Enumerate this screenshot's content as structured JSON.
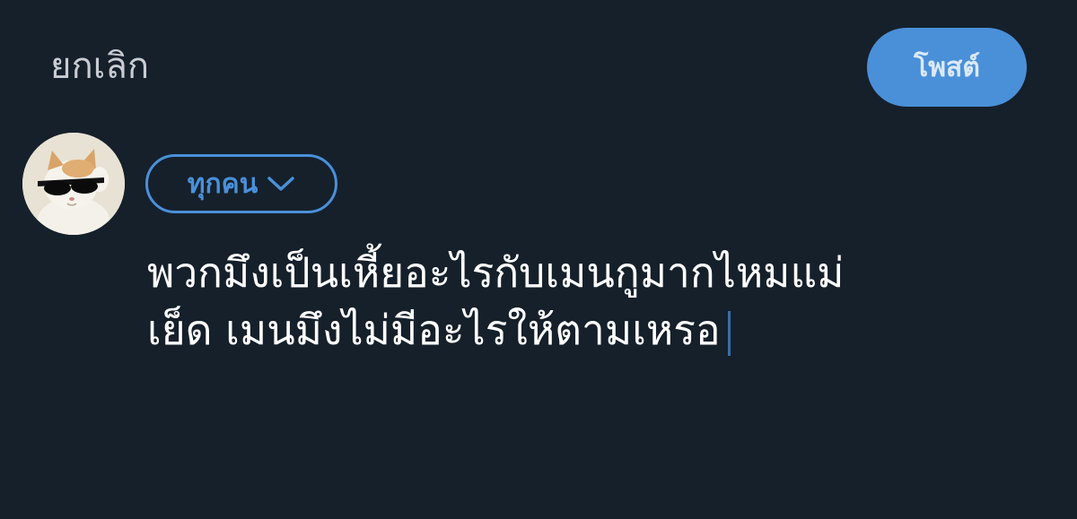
{
  "header": {
    "cancel_label": "ยกเลิก",
    "post_label": "โพสต์"
  },
  "composer": {
    "audience_label": "ทุกคน",
    "lines": [
      "พวกมึงเป็นเหี้ยอะไรกับเมนกูมากไหมแม่",
      "เย็ด เมนมึงไม่มีอะไรให้ตามเหรอ"
    ]
  },
  "icons": {
    "avatar": "cat-with-sunglasses-avatar",
    "audience_chevron": "chevron-down-icon"
  },
  "colors": {
    "background": "#15202b",
    "accent": "#4a90d9",
    "text": "#ffffff",
    "muted": "#c9ccd1"
  }
}
